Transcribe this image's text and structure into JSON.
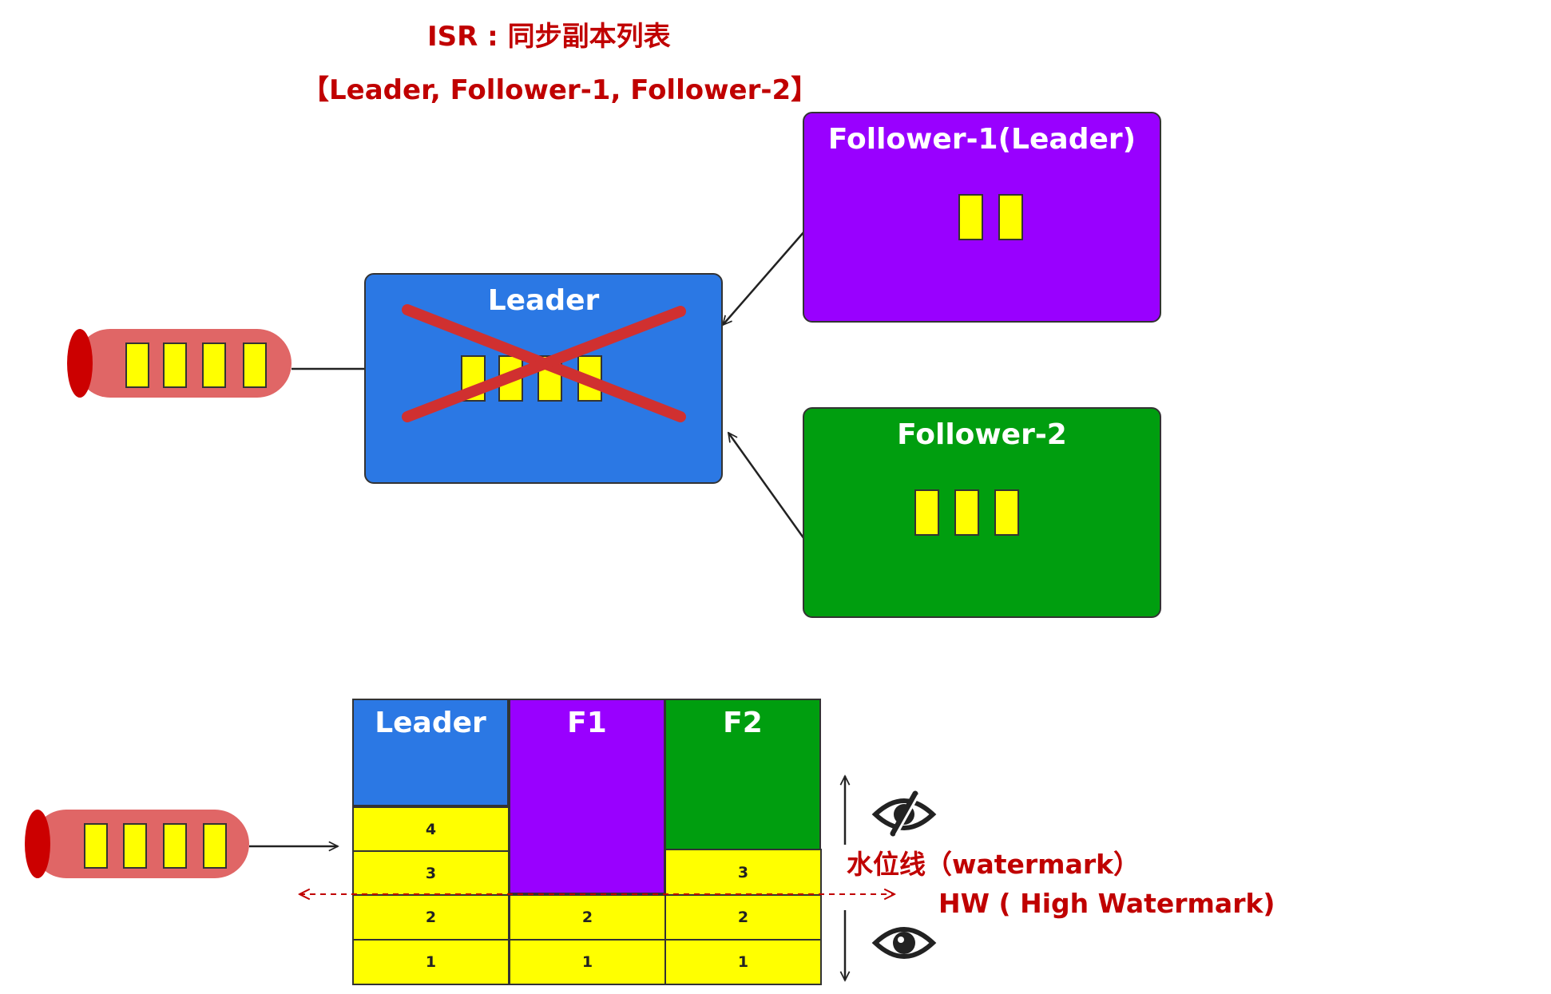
{
  "header": {
    "isr_title": "ISR : 同步副本列表",
    "isr_list": "【Leader, Follower-1, Follower-2】"
  },
  "top_diagram": {
    "leader_label": "Leader",
    "leader_blocks": 4,
    "follower1_label": "Follower-1(Leader)",
    "follower1_blocks": 2,
    "follower2_label": "Follower-2",
    "follower2_blocks": 3,
    "producer_blocks": 4
  },
  "bottom_diagram": {
    "columns": [
      "Leader",
      "F1",
      "F2"
    ],
    "leader_offsets": [
      "4",
      "3",
      "2",
      "1"
    ],
    "f1_offsets": [
      "2",
      "1"
    ],
    "f2_offsets": [
      "3",
      "2",
      "1"
    ],
    "watermark_label": "水位线（watermark）",
    "hw_label": "HW ( High Watermark)",
    "producer_blocks": 4
  },
  "colors": {
    "title_red": "#C00000",
    "leader_blue": "#2B78E4",
    "follower1_purple": "#9900FF",
    "follower2_green": "#009E0F",
    "block_yellow": "#FFFF00",
    "cross_red": "#D03030",
    "producer_pink": "#E06666",
    "producer_cap": "#CC0000"
  },
  "icons": {
    "hidden": "eye-slash-icon",
    "visible": "eye-icon"
  }
}
